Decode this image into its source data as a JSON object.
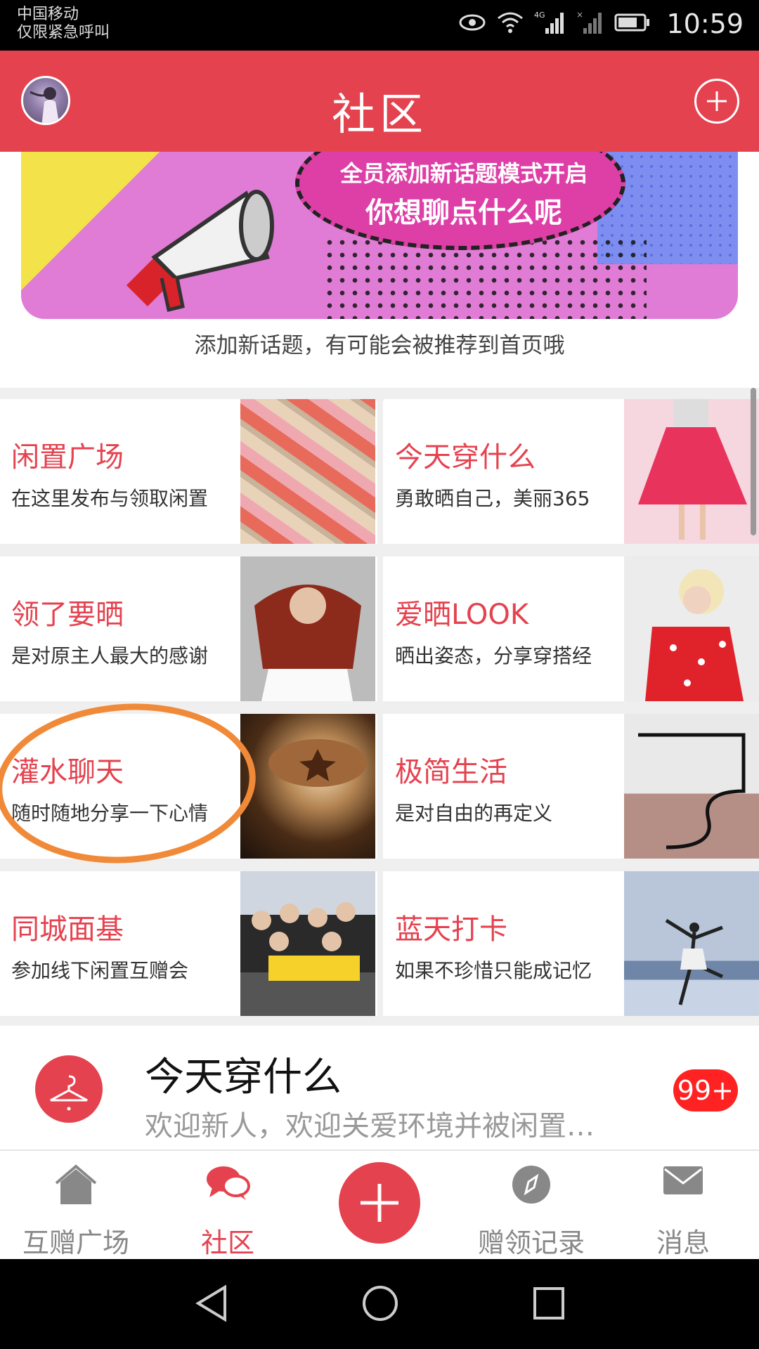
{
  "status_bar": {
    "carrier_line1": "中国移动",
    "carrier_line2": "仅限紧急呼叫",
    "network": "4G",
    "time": "10:59"
  },
  "header": {
    "title": "社区",
    "add_icon": "plus-circle-icon"
  },
  "banner": {
    "line1": "全员添加新话题模式开启",
    "line2": "你想聊点什么呢",
    "caption": "添加新话题，有可能会被推荐到首页哦"
  },
  "topics": [
    {
      "name": "闲置广场",
      "desc": "在这里发布与领取闲置"
    },
    {
      "name": "今天穿什么",
      "desc": "勇敢晒自己，美丽365"
    },
    {
      "name": "领了要晒",
      "desc": "是对原主人最大的感谢"
    },
    {
      "name": "爱晒LOOK",
      "desc": "晒出姿态，分享穿搭经"
    },
    {
      "name": "灌水聊天",
      "desc": "随时随地分享一下心情"
    },
    {
      "name": "极简生活",
      "desc": "是对自由的再定义"
    },
    {
      "name": "同城面基",
      "desc": "参加线下闲置互赠会"
    },
    {
      "name": "蓝天打卡",
      "desc": "如果不珍惜只能成记忆"
    }
  ],
  "notice": {
    "title": "今天穿什么",
    "subtitle": "欢迎新人，欢迎关爱环境并被闲置…",
    "badge": "99+",
    "icon": "hanger-icon"
  },
  "tabbar": {
    "items": [
      {
        "label": "互赠广场",
        "icon": "home-icon"
      },
      {
        "label": "社区",
        "icon": "chat-bubbles-icon"
      },
      {
        "label": "",
        "icon": "plus-icon"
      },
      {
        "label": "赠领记录",
        "icon": "compass-icon"
      },
      {
        "label": "消息",
        "icon": "mail-icon"
      }
    ],
    "active_index": 1
  },
  "colors": {
    "accent": "#e5424f",
    "annotation": "#f08a38"
  }
}
